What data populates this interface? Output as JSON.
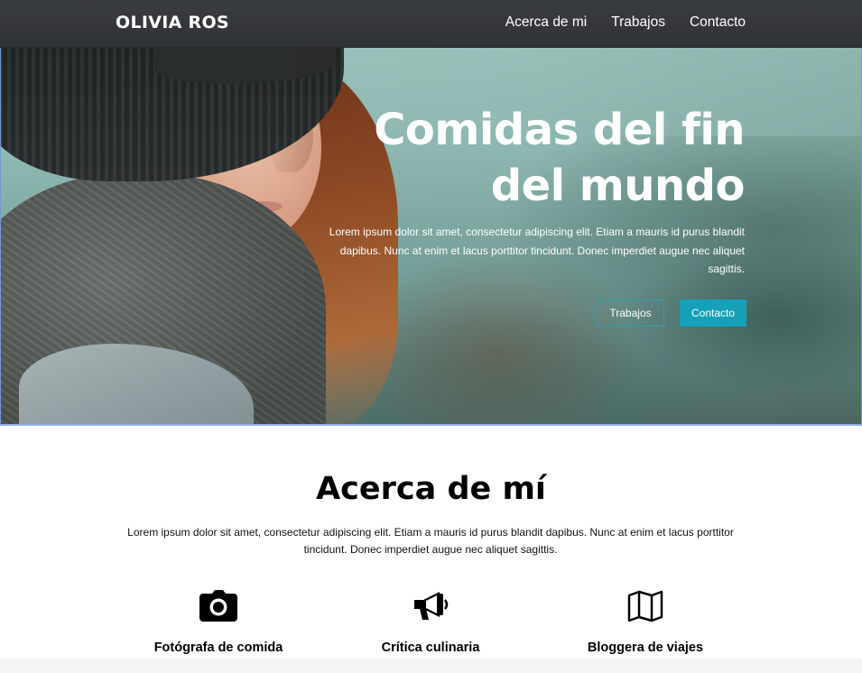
{
  "brand": "OLIVIA ROS",
  "nav": {
    "about": "Acerca de mi",
    "work": "Trabajos",
    "contact": "Contacto"
  },
  "hero": {
    "title_line1": "Comidas del fin",
    "title_line2": "del mundo",
    "text": "Lorem ipsum dolor sit amet, consectetur adipiscing elit. Etiam a mauris id purus blandit dapibus. Nunc at enim et lacus porttitor tincidunt. Donec imperdiet augue nec aliquet sagittis.",
    "button_work": "Trabajos",
    "button_contact": "Contacto"
  },
  "about": {
    "title": "Acerca de mí",
    "text": "Lorem ipsum dolor sit amet, consectetur adipiscing elit. Etiam a mauris id purus blandit dapibus. Nunc at enim et lacus porttitor tincidunt. Donec imperdiet augue nec aliquet sagittis.",
    "features": [
      {
        "icon": "camera-icon",
        "label": "Fotógrafa de comida"
      },
      {
        "icon": "megaphone-icon",
        "label": "Crítica culinaria"
      },
      {
        "icon": "map-icon",
        "label": "Bloggera de viajes"
      }
    ]
  },
  "colors": {
    "navbar": "#333638",
    "accent": "#16a0ba",
    "text_dark": "#000000"
  }
}
